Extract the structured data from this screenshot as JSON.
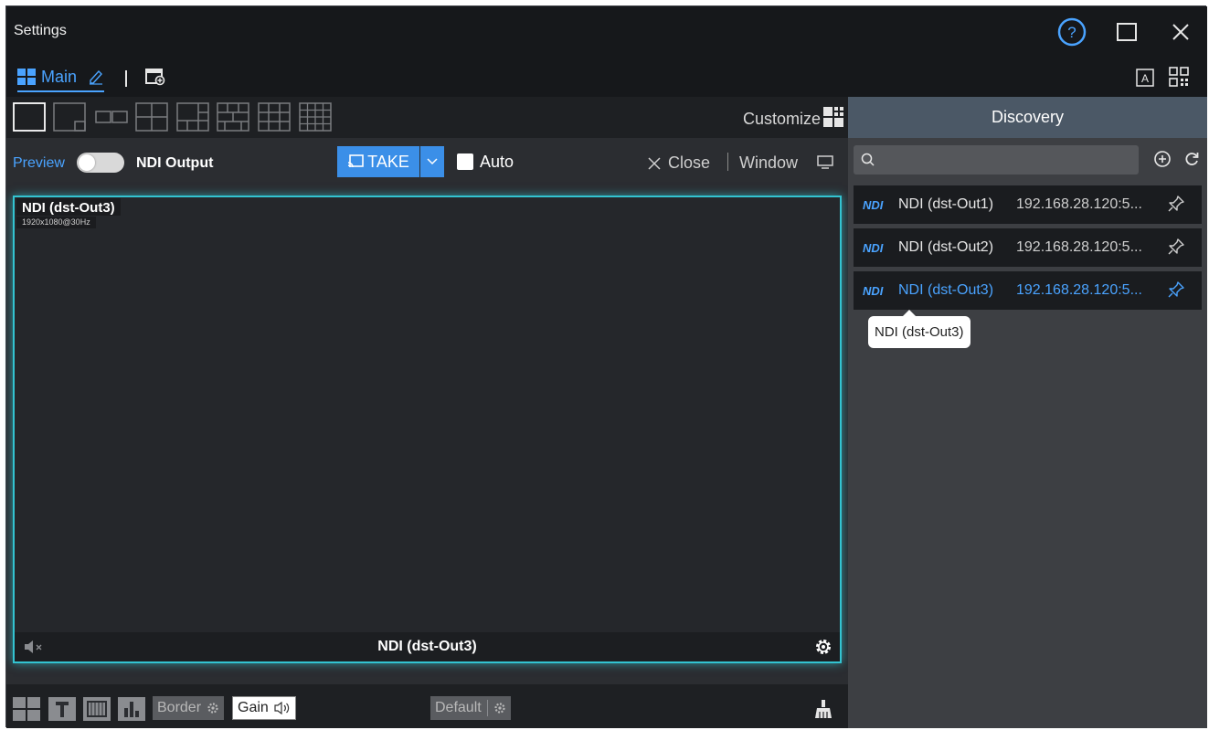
{
  "window": {
    "title": "Settings",
    "buttons": [
      "help-icon",
      "maximize-icon",
      "close-icon"
    ]
  },
  "tabs": {
    "main_label": "Main"
  },
  "layout_toolbar": {
    "customize_label": "Customize"
  },
  "controls": {
    "preview_label": "Preview",
    "ndi_output_label": "NDI Output",
    "take_label": "TAKE",
    "auto_label": "Auto",
    "close_label": "Close",
    "window_label": "Window"
  },
  "preview_panel": {
    "source_name": "NDI (dst-Out3)",
    "resolution": "1920x1080@30Hz",
    "bottom_name": "NDI (dst-Out3)"
  },
  "bottom_toolbar": {
    "border_label": "Border",
    "gain_label": "Gain",
    "default_label": "Default"
  },
  "discovery": {
    "title": "Discovery",
    "search_placeholder": "",
    "devices": [
      {
        "badge": "NDI",
        "name": "NDI (dst-Out1)",
        "ip": "192.168.28.120:5..."
      },
      {
        "badge": "NDI",
        "name": "NDI (dst-Out2)",
        "ip": "192.168.28.120:5..."
      },
      {
        "badge": "NDI",
        "name": "NDI (dst-Out3)",
        "ip": "192.168.28.120:5..."
      }
    ],
    "tooltip": "NDI (dst-Out3)"
  },
  "colors": {
    "accent": "#4aa3ff",
    "panel_border": "#33c3d1",
    "take_button": "#3b8fe8"
  }
}
